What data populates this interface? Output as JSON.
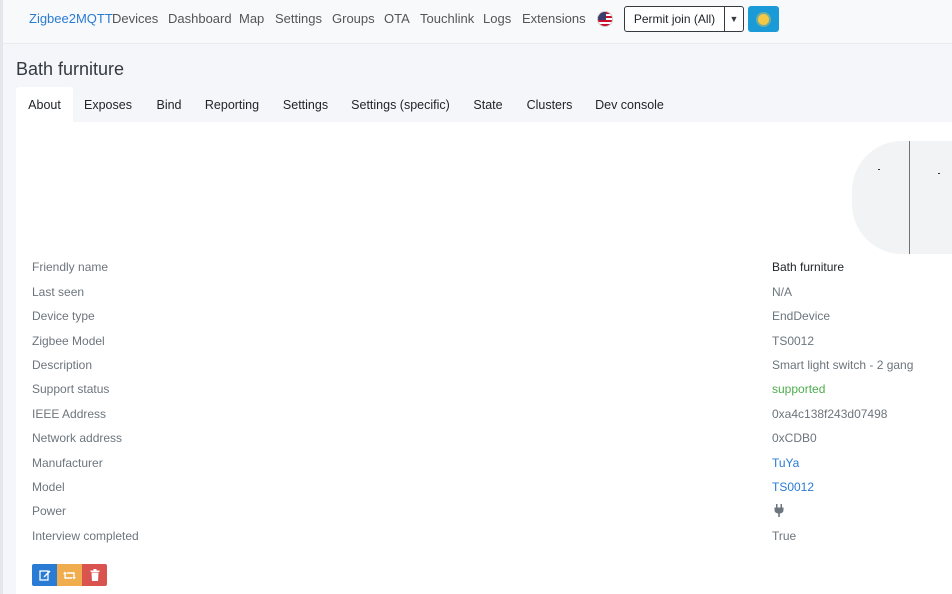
{
  "nav": {
    "brand": "Zigbee2MQTT",
    "links": [
      "Devices",
      "Dashboard",
      "Map",
      "Settings",
      "Groups",
      "OTA",
      "Touchlink",
      "Logs",
      "Extensions"
    ],
    "language_icon": "us-flag-icon",
    "permit_join_label": "Permit join (All)",
    "theme_icon": "sun-icon"
  },
  "page": {
    "title": "Bath furniture"
  },
  "tabs": [
    "About",
    "Exposes",
    "Bind",
    "Reporting",
    "Settings",
    "Settings (specific)",
    "State",
    "Clusters",
    "Dev console"
  ],
  "active_tab": "About",
  "details": [
    {
      "label": "Friendly name",
      "value": "Bath furniture"
    },
    {
      "label": "Last seen",
      "value": "N/A"
    },
    {
      "label": "Device type",
      "value": "EndDevice"
    },
    {
      "label": "Zigbee Model",
      "value": "TS0012"
    },
    {
      "label": "Description",
      "value": "Smart light switch - 2 gang"
    },
    {
      "label": "Support status",
      "value": "supported"
    },
    {
      "label": "IEEE Address",
      "value": "0xa4c138f243d07498"
    },
    {
      "label": "Network address",
      "value": "0xCDB0"
    },
    {
      "label": "Manufacturer",
      "value": "TuYa"
    },
    {
      "label": "Model",
      "value": "TS0012"
    },
    {
      "label": "Power",
      "value": "",
      "icon": "plug-icon"
    },
    {
      "label": "Interview completed",
      "value": "True"
    }
  ],
  "colors": {
    "link": "#2a7bd3",
    "supported": "#4cae4c",
    "edit": "#2a7bd3",
    "reconfigure": "#f0ad4e",
    "delete": "#d9534f"
  }
}
